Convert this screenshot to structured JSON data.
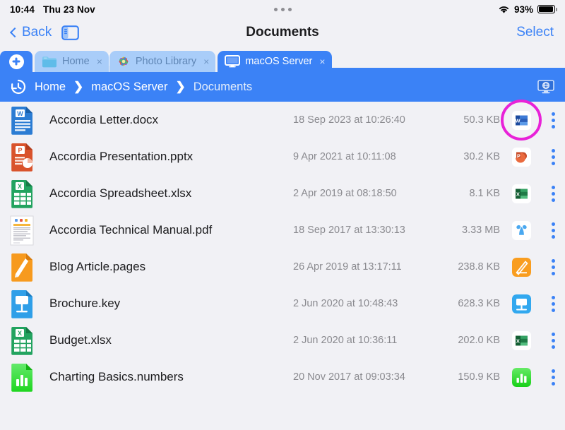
{
  "status_bar": {
    "time": "10:44",
    "date": "Thu 23 Nov",
    "battery_percent": "93%",
    "wifi_icon": "wifi-icon",
    "battery_icon": "battery-icon",
    "multitask_icon": "multitasking-dots-icon"
  },
  "nav_bar": {
    "back_label": "Back",
    "sidebar_toggle_icon": "sidebar-toggle-icon",
    "title": "Documents",
    "select_label": "Select"
  },
  "tab_bar": {
    "add_tab_icon": "plus-circle-icon",
    "tabs": [
      {
        "label": "Home",
        "icon": "folder-icon",
        "close": "×",
        "active": false
      },
      {
        "label": "Photo Library",
        "icon": "photos-icon",
        "close": "×",
        "active": false
      },
      {
        "label": "macOS Server",
        "icon": "display-icon",
        "close": "×",
        "active": true
      }
    ]
  },
  "breadcrumb": {
    "history_icon": "history-clock-icon",
    "crumbs": [
      "Home",
      "macOS Server",
      "Documents"
    ],
    "separator": "❯",
    "server_icon": "network-display-icon"
  },
  "file_list": {
    "rows": [
      {
        "name": "Accordia Letter.docx",
        "date": "18 Sep 2023 at 10:26:40",
        "size": "50.3 KB",
        "doc_icon": "word-document-icon",
        "app_icon": "microsoft-word-app-icon",
        "highlighted": true
      },
      {
        "name": "Accordia Presentation.pptx",
        "date": "9 Apr 2021 at 10:11:08",
        "size": "30.2 KB",
        "doc_icon": "powerpoint-document-icon",
        "app_icon": "microsoft-powerpoint-app-icon",
        "highlighted": false
      },
      {
        "name": "Accordia Spreadsheet.xlsx",
        "date": "2 Apr 2019 at 08:18:50",
        "size": "8.1 KB",
        "doc_icon": "excel-document-icon",
        "app_icon": "microsoft-excel-app-icon",
        "highlighted": false
      },
      {
        "name": "Accordia Technical Manual.pdf",
        "date": "18 Sep 2017 at 13:30:13",
        "size": "3.33 MB",
        "doc_icon": "pdf-page-thumbnail",
        "app_icon": "adobe-acrobat-app-icon",
        "highlighted": false
      },
      {
        "name": "Blog Article.pages",
        "date": "26 Apr 2019 at 13:17:11",
        "size": "238.8 KB",
        "doc_icon": "pages-document-icon",
        "app_icon": "pages-app-icon",
        "highlighted": false
      },
      {
        "name": "Brochure.key",
        "date": "2 Jun 2020 at 10:48:43",
        "size": "628.3 KB",
        "doc_icon": "keynote-document-icon",
        "app_icon": "keynote-app-icon",
        "highlighted": false
      },
      {
        "name": "Budget.xlsx",
        "date": "2 Jun 2020 at 10:36:11",
        "size": "202.0 KB",
        "doc_icon": "excel-document-icon",
        "app_icon": "microsoft-excel-app-icon",
        "highlighted": false
      },
      {
        "name": "Charting Basics.numbers",
        "date": "20 Nov 2017 at 09:03:34",
        "size": "150.9 KB",
        "doc_icon": "numbers-document-icon",
        "app_icon": "numbers-app-icon",
        "highlighted": false
      }
    ],
    "overflow_menu_icon": "more-vertical-icon"
  },
  "colors": {
    "accent": "#3b82f6",
    "background": "#f1f1f5",
    "highlight_ring": "#e822d8"
  }
}
